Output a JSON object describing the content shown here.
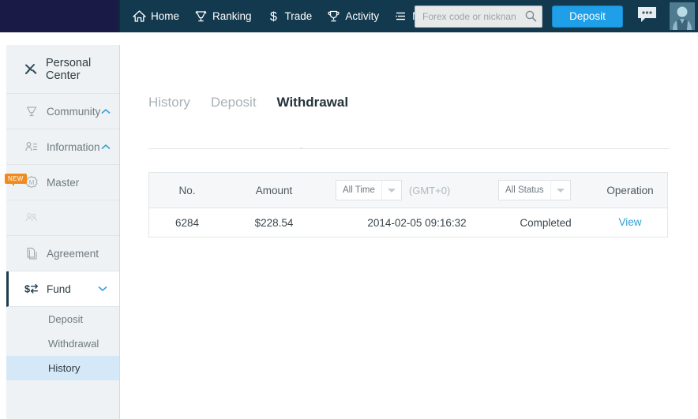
{
  "header": {
    "nav_items": [
      {
        "label": "Home",
        "icon": "home-icon"
      },
      {
        "label": "Ranking",
        "icon": "ranking-icon"
      },
      {
        "label": "Trade",
        "icon": "dollar-icon"
      },
      {
        "label": "Activity",
        "icon": "trophy-icon"
      },
      {
        "label": "More",
        "icon": "list-icon"
      }
    ],
    "search": {
      "placeholder": "Forex code or nicknan",
      "value": "",
      "icon": "search-icon"
    },
    "deposit_label": "Deposit",
    "chat_icon": "chat-bubble-icon",
    "avatar_icon": "user-avatar",
    "bg_left": "#1a1a46",
    "bg_right": "#13394e",
    "deposit_color": "#1e9fe8"
  },
  "sidebar": {
    "title": "Personal Center",
    "title_icon": "tools-icon",
    "items": [
      {
        "label": "Community",
        "icon": "ranking-icon",
        "caret": "chevron-up-icon",
        "state": "normal"
      },
      {
        "label": "Information",
        "icon": "contact-icon",
        "caret": "chevron-up-icon",
        "state": "normal"
      },
      {
        "label": "Master",
        "icon": "medal-icon",
        "caret": "",
        "state": "normal",
        "badge": "NEW"
      },
      {
        "label": "",
        "icon": "people-icon",
        "caret": "",
        "state": "ghost"
      },
      {
        "label": "Agreement",
        "icon": "documents-icon",
        "caret": "",
        "state": "normal"
      },
      {
        "label": "Fund",
        "icon": "fund-exchange-icon",
        "caret": "chevron-down-icon",
        "state": "active"
      }
    ],
    "submenu": [
      {
        "label": "Deposit",
        "selected": false
      },
      {
        "label": "Withdrawal",
        "selected": false
      },
      {
        "label": "History",
        "selected": true
      }
    ],
    "highlight_color": "#d4e8f8",
    "badge_color": "#f08c1e"
  },
  "main": {
    "tabs": [
      {
        "label": "History",
        "active": false
      },
      {
        "label": "Deposit",
        "active": false
      },
      {
        "label": "Withdrawal",
        "active": true
      }
    ],
    "table": {
      "columns": [
        "No.",
        "Amount",
        "",
        "",
        "Operation"
      ],
      "headers": {
        "no": "No.",
        "amount": "Amount",
        "time_filter": "All Time",
        "timezone": "(GMT+0)",
        "status_filter": "All Status",
        "operation": "Operation"
      },
      "rows": [
        {
          "no": "6284",
          "amount": "$228.54",
          "time": "2014-02-05 09:16:32",
          "status": "Completed",
          "operation": "View"
        }
      ]
    }
  }
}
